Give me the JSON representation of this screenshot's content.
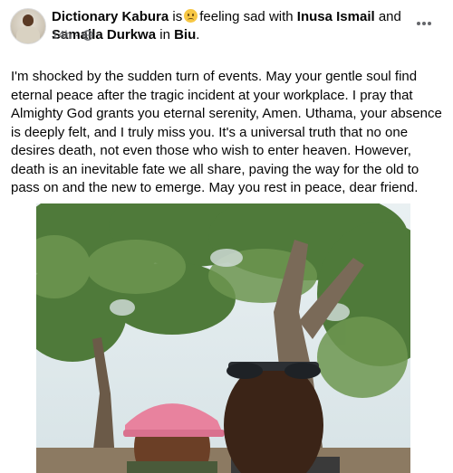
{
  "post": {
    "author": "Dictionary Kabura",
    "connector_is": "is",
    "feeling": "feeling sad with",
    "tagged_1": "Inusa Ismail",
    "and": "and",
    "tagged_2": "Samaila Durkwa",
    "in_word": "in",
    "location": "Biu",
    "period": ".",
    "time": "14h",
    "dot": "·",
    "privacy_icon": "globe-icon",
    "feeling_icon": "sad-face-emoji-icon",
    "more_icon": "more-horizontal-icon",
    "caption": "I'm shocked by the sudden turn of events. May your gentle soul find eternal peace after the tragic incident at your workplace. I pray that Almighty God grants you eternal serenity, Amen. Uthama, your absence is deeply felt, and I truly miss you. It's a universal truth that no one desires death, not even those who wish to enter heaven. However, death is an inevitable fate we all share, paving the way for the old to pass on and the new to emerge. May you rest in peace, dear friend."
  },
  "colors": {
    "text_primary": "#050505",
    "text_secondary": "#65676b",
    "emoji": "#f7c744",
    "cap_pink": "#e8829e"
  }
}
